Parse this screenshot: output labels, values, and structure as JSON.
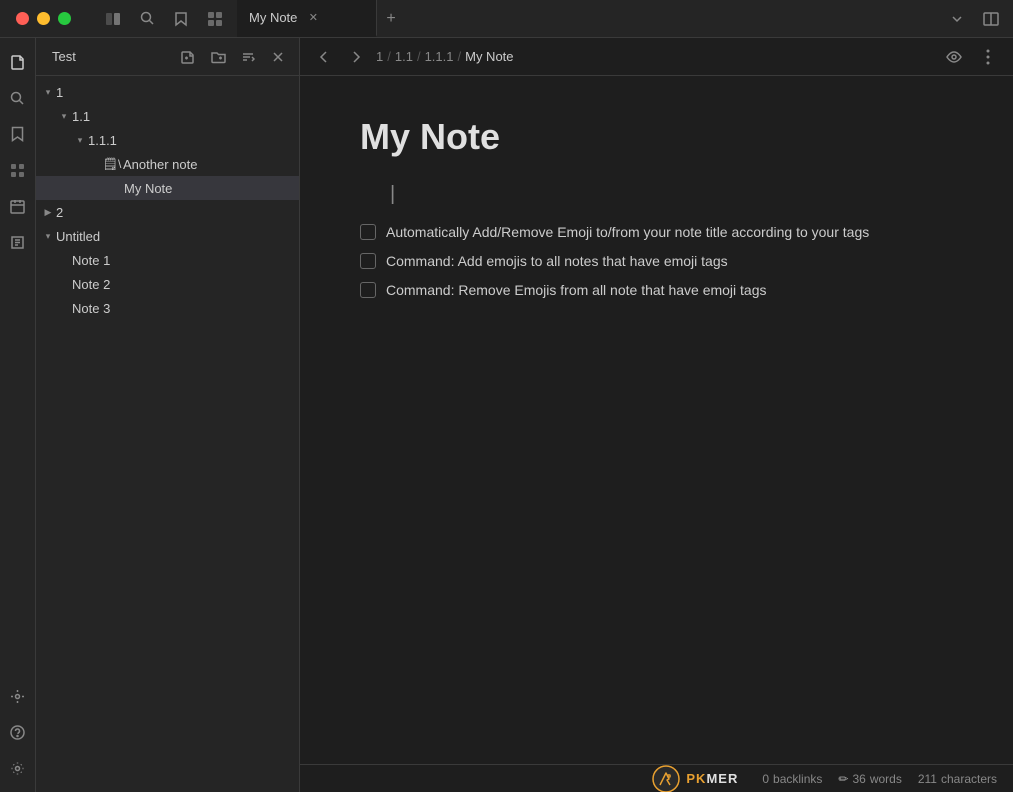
{
  "titlebar": {
    "tab_label": "My Note",
    "new_tab_icon": "+"
  },
  "sidebar": {
    "section_label": "Test",
    "toolbar": {
      "new_note_icon": "📄",
      "new_folder_icon": "📁",
      "sort_icon": "↕",
      "close_icon": "✕"
    },
    "tree": [
      {
        "id": "1",
        "label": "1",
        "level": 0,
        "expanded": true,
        "toggle": "▾",
        "icon": ""
      },
      {
        "id": "1.1",
        "label": "1.1",
        "level": 1,
        "expanded": true,
        "toggle": "▾",
        "icon": ""
      },
      {
        "id": "1.1.1",
        "label": "1.1.1",
        "level": 2,
        "expanded": true,
        "toggle": "▾",
        "icon": ""
      },
      {
        "id": "another-note",
        "label": "Another note",
        "level": 3,
        "expanded": false,
        "toggle": "",
        "icon": "🗒\\"
      },
      {
        "id": "my-note",
        "label": "My Note",
        "level": 3,
        "expanded": false,
        "toggle": "",
        "icon": "",
        "selected": true
      },
      {
        "id": "2",
        "label": "2",
        "level": 0,
        "expanded": false,
        "toggle": "▶",
        "icon": ""
      },
      {
        "id": "untitled",
        "label": "Untitled",
        "level": 0,
        "expanded": true,
        "toggle": "▾",
        "icon": ""
      },
      {
        "id": "note-1",
        "label": "Note 1",
        "level": 1,
        "expanded": false,
        "toggle": "",
        "icon": ""
      },
      {
        "id": "note-2",
        "label": "Note 2",
        "level": 1,
        "expanded": false,
        "toggle": "",
        "icon": ""
      },
      {
        "id": "note-3",
        "label": "Note 3",
        "level": 1,
        "expanded": false,
        "toggle": "",
        "icon": ""
      }
    ]
  },
  "breadcrumb": {
    "parts": [
      "1",
      "1.1",
      "1.1.1",
      "My Note"
    ],
    "separators": [
      "/",
      "/",
      "/"
    ]
  },
  "note": {
    "title": "My Note",
    "checklist": [
      {
        "id": "item-1",
        "checked": false,
        "text": "Automatically Add/Remove Emoji to/from your note title according to your tags"
      },
      {
        "id": "item-2",
        "checked": false,
        "text": "Command: Add emojis to all notes  that have emoji tags"
      },
      {
        "id": "item-3",
        "checked": false,
        "text": "Command: Remove Emojis from all note that have emoji tags"
      }
    ]
  },
  "status_bar": {
    "backlinks_count": "0",
    "backlinks_label": "backlinks",
    "words_count": "36",
    "words_label": "words",
    "characters_count": "211",
    "characters_label": "characters"
  },
  "activity_bar": {
    "icons": [
      "files",
      "search",
      "bookmarks",
      "grid",
      "calendar",
      "pages",
      "terminal"
    ]
  }
}
